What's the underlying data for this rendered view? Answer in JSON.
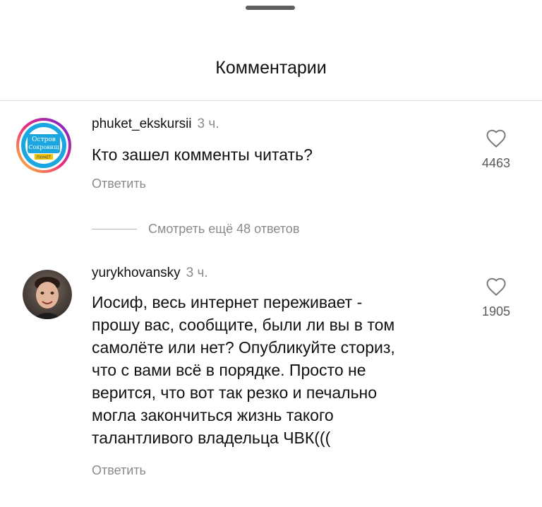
{
  "sheet": {
    "title": "Комментарии"
  },
  "comments": [
    {
      "username": "phuket_ekskursii",
      "time": "3 ч.",
      "text": "Кто зашел комменты читать?",
      "reply_label": "Ответить",
      "likes": "4463",
      "avatar_text": {
        "line1": "Остров",
        "line2": "Сокровищ",
        "line3": "ПХУКЕТ"
      }
    },
    {
      "username": "yurykhovansky",
      "time": "3 ч.",
      "text_lines": [
        "Иосиф, весь интернет переживает -",
        "прошу вас, сообщите, были ли вы в том",
        "самолёте или нет? Опубликуйте сториз,",
        "что с вами всё в порядке. Просто не",
        "верится, что вот так резко и печально",
        "могла закончиться жизнь такого",
        "талантливого владельца ЧВК((("
      ],
      "reply_label": "Ответить",
      "likes": "1905"
    }
  ],
  "view_replies": {
    "label": "Смотреть ещё 48 ответов"
  },
  "colors": {
    "secondary_text": "#8a8a8a",
    "story_ring": [
      "#f9ce34",
      "#ee2a7b",
      "#6228d7"
    ]
  },
  "icons": {
    "like": "heart-outline-icon"
  }
}
